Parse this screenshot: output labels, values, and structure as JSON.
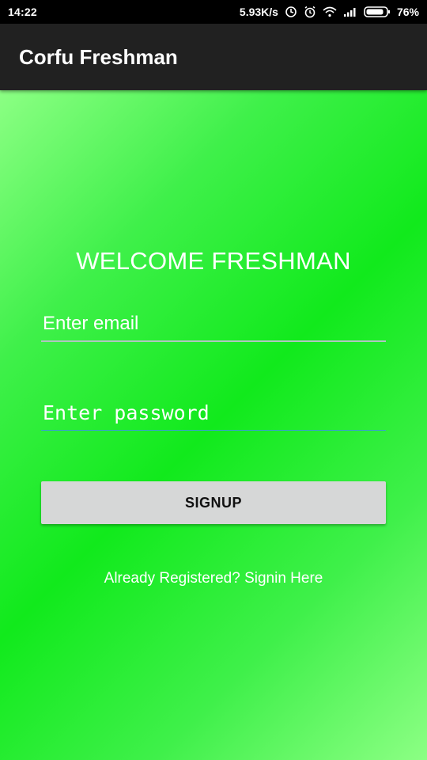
{
  "status_bar": {
    "time": "14:22",
    "network_speed": "5.93K/s",
    "battery_percent": "76%",
    "icons": [
      "sync-icon",
      "alarm-icon",
      "wifi-icon",
      "signal-icon",
      "battery-icon"
    ]
  },
  "app_bar": {
    "title": "Corfu Freshman"
  },
  "main": {
    "welcome_text": "WELCOME FRESHMAN",
    "email_placeholder": "Enter email",
    "password_placeholder": "Enter password",
    "signup_label": "SIGNUP",
    "signin_link_text": "Already Registered? Signin Here"
  },
  "colors": {
    "app_bar": "#212121",
    "background_green": "#11ea1c",
    "button": "#d6d7d7"
  }
}
